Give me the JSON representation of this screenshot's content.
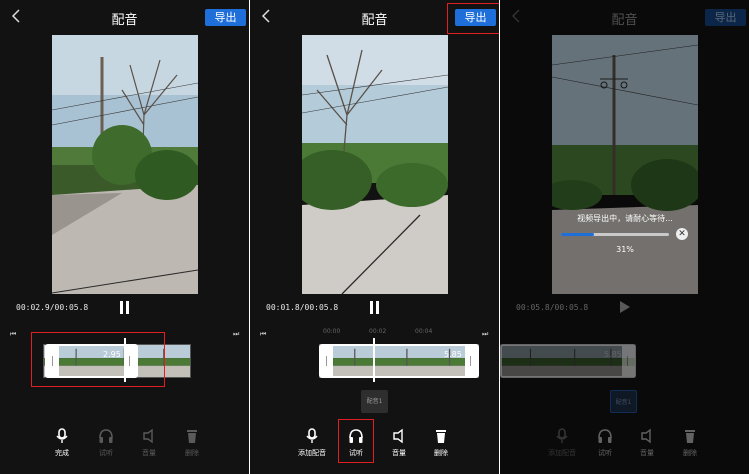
{
  "colors": {
    "accent": "#1e6fd9",
    "background": "#121212",
    "highlight": "#e02020"
  },
  "panels": [
    {
      "title": "配音",
      "export_label": "导出",
      "time": "00:02.9/00:05.8",
      "playback_state": "playing",
      "clip_label": "2.95",
      "tools": [
        "完成",
        "试听",
        "音量",
        "删除"
      ]
    },
    {
      "title": "配音",
      "export_label": "导出",
      "time": "00:01.8/00:05.8",
      "playback_state": "playing",
      "ruler": [
        "00:00",
        "00:02",
        "00:04"
      ],
      "clip_label": "5.85",
      "chip_label": "配音1",
      "tools": [
        "添加配音",
        "试听",
        "音量",
        "删除"
      ]
    },
    {
      "title": "配音",
      "export_label": "导出",
      "time": "00:05.8/00:05.8",
      "playback_state": "paused",
      "clip_label": "5.85",
      "chip_label": "配音1",
      "progress_message": "视频导出中，请耐心等待...",
      "progress_percent": "31%",
      "progress_value": 0.31,
      "tools": [
        "添加配音",
        "试听",
        "音量",
        "删除"
      ]
    }
  ],
  "icons": {
    "back": "chevron-left-icon",
    "skip_start": "skip-to-start-icon",
    "skip_end": "skip-to-end-icon",
    "microphone": "microphone-icon",
    "headphones": "headphones-icon",
    "volume": "speaker-icon",
    "delete": "trash-icon",
    "close": "close-circle-icon"
  }
}
